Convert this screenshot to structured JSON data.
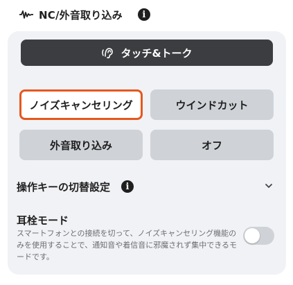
{
  "header": {
    "title": "NC/外音取り込み",
    "icon": "waveform-icon",
    "info_icon": "info-icon"
  },
  "touch_talk": {
    "label": "タッチ&トーク",
    "icon": "ear-icon"
  },
  "modes": {
    "selected": "noise_cancel",
    "accent_color": "#e4581e",
    "noise_cancel": "ノイズキャンセリング",
    "wind_cut": "ウインドカット",
    "ambient": "外音取り込み",
    "off": "オフ"
  },
  "operation_key": {
    "label": "操作キーの切替設定",
    "info_icon": "info-icon",
    "expand_icon": "chevron-down-icon"
  },
  "earplug_mode": {
    "title": "耳栓モード",
    "description": "スマートフォンとの接続を切って、ノイズキャンセリング機能のみを使用することで、通知音や着信音に邪魔されず集中できるモードです。",
    "enabled": false
  }
}
